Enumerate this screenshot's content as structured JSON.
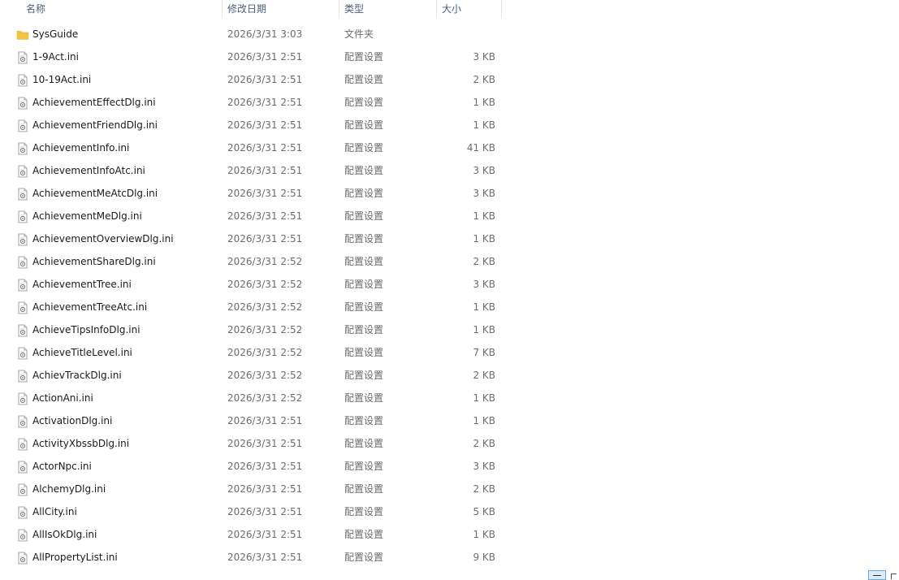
{
  "columns": {
    "name": "名称",
    "date": "修改日期",
    "type": "类型",
    "size": "大小"
  },
  "files": [
    {
      "name": "SysGuide",
      "date": "2026/3/31 3:03",
      "type": "文件夹",
      "size": "",
      "icon": "folder-icon"
    },
    {
      "name": "1-9Act.ini",
      "date": "2026/3/31 2:51",
      "type": "配置设置",
      "size": "3 KB",
      "icon": "ini-file-icon"
    },
    {
      "name": "10-19Act.ini",
      "date": "2026/3/31 2:51",
      "type": "配置设置",
      "size": "2 KB",
      "icon": "ini-file-icon"
    },
    {
      "name": "AchievementEffectDlg.ini",
      "date": "2026/3/31 2:51",
      "type": "配置设置",
      "size": "1 KB",
      "icon": "ini-file-icon"
    },
    {
      "name": "AchievementFriendDlg.ini",
      "date": "2026/3/31 2:51",
      "type": "配置设置",
      "size": "1 KB",
      "icon": "ini-file-icon"
    },
    {
      "name": "AchievementInfo.ini",
      "date": "2026/3/31 2:51",
      "type": "配置设置",
      "size": "41 KB",
      "icon": "ini-file-icon"
    },
    {
      "name": "AchievementInfoAtc.ini",
      "date": "2026/3/31 2:51",
      "type": "配置设置",
      "size": "3 KB",
      "icon": "ini-file-icon"
    },
    {
      "name": "AchievementMeAtcDlg.ini",
      "date": "2026/3/31 2:51",
      "type": "配置设置",
      "size": "3 KB",
      "icon": "ini-file-icon"
    },
    {
      "name": "AchievementMeDlg.ini",
      "date": "2026/3/31 2:51",
      "type": "配置设置",
      "size": "1 KB",
      "icon": "ini-file-icon"
    },
    {
      "name": "AchievementOverviewDlg.ini",
      "date": "2026/3/31 2:51",
      "type": "配置设置",
      "size": "1 KB",
      "icon": "ini-file-icon"
    },
    {
      "name": "AchievementShareDlg.ini",
      "date": "2026/3/31 2:52",
      "type": "配置设置",
      "size": "2 KB",
      "icon": "ini-file-icon"
    },
    {
      "name": "AchievementTree.ini",
      "date": "2026/3/31 2:52",
      "type": "配置设置",
      "size": "3 KB",
      "icon": "ini-file-icon"
    },
    {
      "name": "AchievementTreeAtc.ini",
      "date": "2026/3/31 2:52",
      "type": "配置设置",
      "size": "1 KB",
      "icon": "ini-file-icon"
    },
    {
      "name": "AchieveTipsInfoDlg.ini",
      "date": "2026/3/31 2:52",
      "type": "配置设置",
      "size": "1 KB",
      "icon": "ini-file-icon"
    },
    {
      "name": "AchieveTitleLevel.ini",
      "date": "2026/3/31 2:52",
      "type": "配置设置",
      "size": "7 KB",
      "icon": "ini-file-icon"
    },
    {
      "name": "AchievTrackDlg.ini",
      "date": "2026/3/31 2:52",
      "type": "配置设置",
      "size": "2 KB",
      "icon": "ini-file-icon"
    },
    {
      "name": "ActionAni.ini",
      "date": "2026/3/31 2:52",
      "type": "配置设置",
      "size": "1 KB",
      "icon": "ini-file-icon"
    },
    {
      "name": "ActivationDlg.ini",
      "date": "2026/3/31 2:51",
      "type": "配置设置",
      "size": "1 KB",
      "icon": "ini-file-icon"
    },
    {
      "name": "ActivityXbssbDlg.ini",
      "date": "2026/3/31 2:51",
      "type": "配置设置",
      "size": "2 KB",
      "icon": "ini-file-icon"
    },
    {
      "name": "ActorNpc.ini",
      "date": "2026/3/31 2:51",
      "type": "配置设置",
      "size": "3 KB",
      "icon": "ini-file-icon"
    },
    {
      "name": "AlchemyDlg.ini",
      "date": "2026/3/31 2:51",
      "type": "配置设置",
      "size": "2 KB",
      "icon": "ini-file-icon"
    },
    {
      "name": "AllCity.ini",
      "date": "2026/3/31 2:51",
      "type": "配置设置",
      "size": "5 KB",
      "icon": "ini-file-icon"
    },
    {
      "name": "AllIsOkDlg.ini",
      "date": "2026/3/31 2:51",
      "type": "配置设置",
      "size": "1 KB",
      "icon": "ini-file-icon"
    },
    {
      "name": "AllPropertyList.ini",
      "date": "2026/3/31 2:51",
      "type": "配置设置",
      "size": "9 KB",
      "icon": "ini-file-icon"
    }
  ],
  "colors": {
    "folder": "#f3c343",
    "header_text": "#4c607a",
    "secondary_text": "#6d6d6d"
  }
}
